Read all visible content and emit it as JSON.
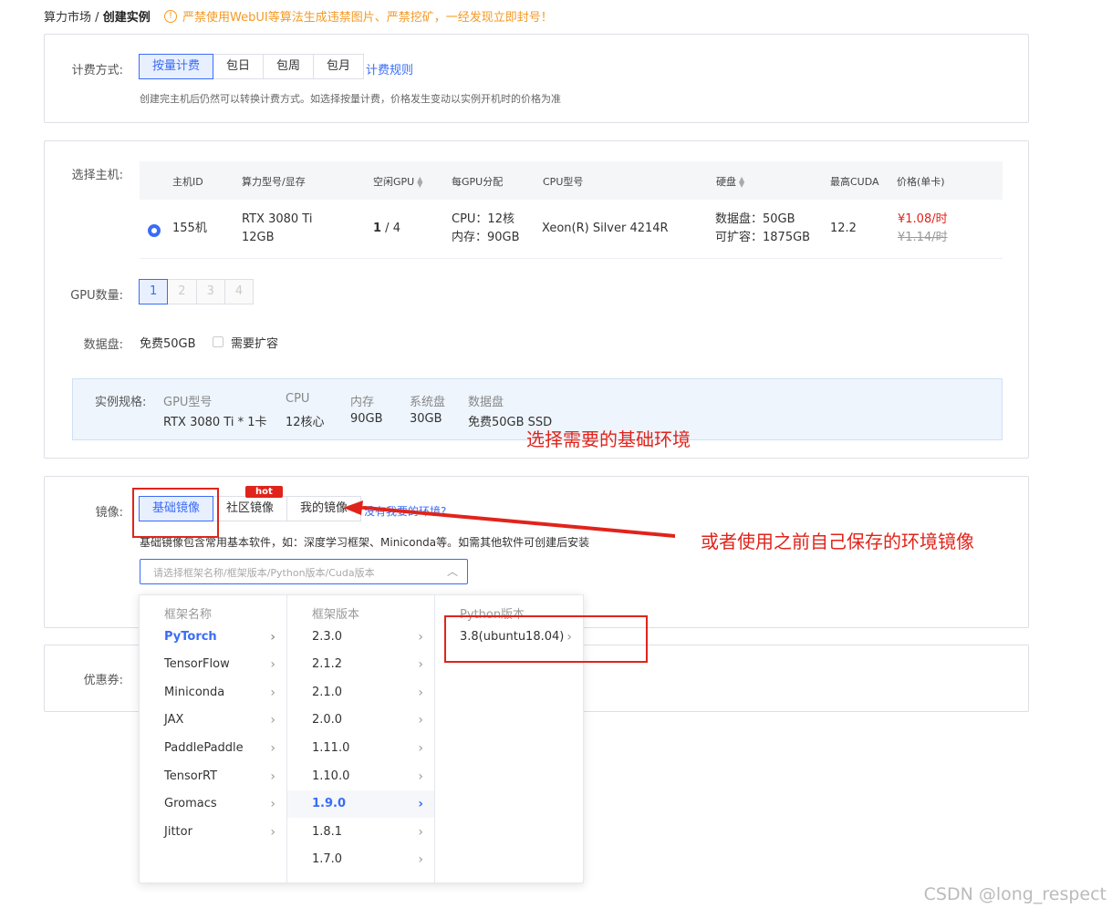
{
  "breadcrumb": {
    "root": "算力市场",
    "sep": "/",
    "current": "创建实例"
  },
  "warning": {
    "icon": "!",
    "text": "严禁使用WebUI等算法生成违禁图片、严禁挖矿，一经发现立即封号！"
  },
  "billing": {
    "label": "计费方式:",
    "options": [
      "按量计费",
      "包日",
      "包周",
      "包月"
    ],
    "selected": "按量计费",
    "rules_link": "计费规则",
    "hint": "创建完主机后仍然可以转换计费方式。如选择按量计费，价格发生变动以实例开机时的价格为准"
  },
  "host": {
    "label": "选择主机:",
    "columns": [
      "主机ID",
      "算力型号/显存",
      "空闲GPU",
      "每GPU分配",
      "CPU型号",
      "硬盘",
      "最高CUDA",
      "价格(单卡)"
    ],
    "row": {
      "id": "155机",
      "model_line1": "RTX 3080 Ti",
      "model_line2": "12GB",
      "free_gpu_bold": "1",
      "free_gpu_total": " / 4",
      "cpu_alloc": "CPU：12核",
      "mem_alloc": "内存：90GB",
      "cpu_model": "Xeon(R) Silver 4214R",
      "disk_line1": "数据盘：50GB",
      "disk_line2": "可扩容：1875GB",
      "cuda": "12.2",
      "price": "¥1.08/时",
      "old_price": "¥1.14/时"
    }
  },
  "gpu_count": {
    "label": "GPU数量:",
    "options": [
      "1",
      "2",
      "3",
      "4"
    ],
    "selected": "1"
  },
  "data_disk": {
    "label": "数据盘:",
    "free": "免费50GB",
    "expand_label": "需要扩容",
    "expand_checked": false
  },
  "spec": {
    "label": "实例规格:",
    "headers": [
      "GPU型号",
      "CPU",
      "内存",
      "系统盘",
      "数据盘"
    ],
    "values": [
      "RTX 3080 Ti * 1卡",
      "12核心",
      "90GB",
      "30GB",
      "免费50GB SSD"
    ]
  },
  "image": {
    "label": "镜像:",
    "tabs": [
      "基础镜像",
      "社区镜像",
      "我的镜像"
    ],
    "selected": "基础镜像",
    "hot_badge": "hot",
    "missing_link": "没有我要的环境?",
    "hint": "基础镜像包含常用基本软件，如：深度学习框架、Miniconda等。如需其他软件可创建后安装",
    "select_placeholder": "请选择框架名称/框架版本/Python版本/Cuda版本"
  },
  "coupon": {
    "label": "优惠券:"
  },
  "dropdown": {
    "col1_header": "框架名称",
    "frameworks": [
      "PyTorch",
      "TensorFlow",
      "Miniconda",
      "JAX",
      "PaddlePaddle",
      "TensorRT",
      "Gromacs",
      "Jittor"
    ],
    "col2_header": "框架版本",
    "versions": [
      "2.3.0",
      "2.1.2",
      "2.1.0",
      "2.0.0",
      "1.11.0",
      "1.10.0",
      "1.9.0",
      "1.8.1",
      "1.7.0"
    ],
    "col3_header": "Python版本",
    "python_versions": [
      "3.8(ubuntu18.04)"
    ],
    "selected_framework": "PyTorch",
    "selected_version": "1.9.0"
  },
  "annotations": {
    "text1": "选择需要的基础环境",
    "text2": "或者使用之前自己保存的环境镜像",
    "color": "#e0241b"
  },
  "watermark": "CSDN @long_respect",
  "colors": {
    "accent": "#3a6cf6",
    "warning": "#f59a23",
    "price": "#e0241b"
  }
}
